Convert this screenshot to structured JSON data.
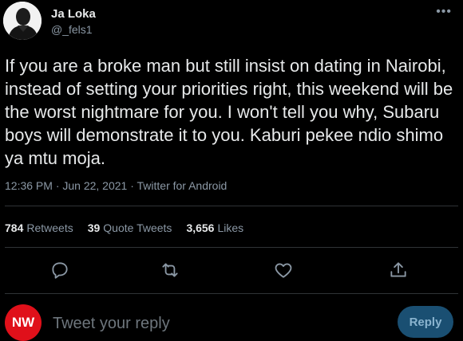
{
  "author": {
    "name": "Ja Loka",
    "handle": "@_fels1"
  },
  "tweet": {
    "text": "If you are a broke man but still insist on dating in Nairobi, instead of setting your priorities right, this weekend will be the worst nightmare for you. I won't tell you why, Subaru boys will demonstrate it to you. Kaburi pekee ndio shimo ya mtu moja.",
    "meta": "12:36 PM · Jun 22, 2021 · Twitter for Android"
  },
  "stats": {
    "retweets_count": "784",
    "retweets_label": "Retweets",
    "quotes_count": "39",
    "quotes_label": "Quote Tweets",
    "likes_count": "3,656",
    "likes_label": "Likes"
  },
  "actions": {
    "reply_icon": "reply-icon",
    "retweet_icon": "retweet-icon",
    "like_icon": "heart-icon",
    "share_icon": "share-icon"
  },
  "reply_bar": {
    "logo_text": "NW",
    "placeholder": "Tweet your reply",
    "button_label": "Reply"
  },
  "colors": {
    "background": "#000000",
    "primary_text": "#e7e9ea",
    "secondary_text": "#8b98a5",
    "brand_red": "#e0101a",
    "reply_button": "#1a4f72"
  }
}
